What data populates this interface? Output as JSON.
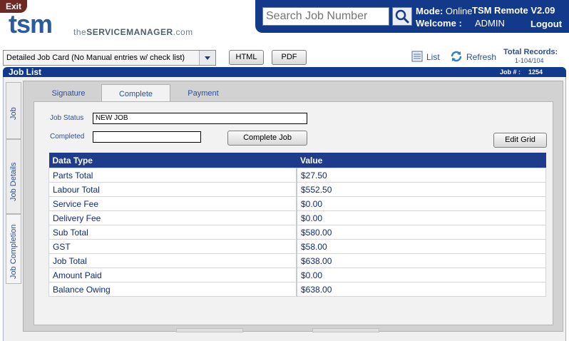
{
  "header": {
    "exit_label": "Exit",
    "logo_main": "tsm",
    "logo_sub_prefix": "the",
    "logo_sub_main": "SERVICEMANAGER",
    "logo_sub_suffix": ".com",
    "search_placeholder": "Search Job Number",
    "mode_label": "Mode:",
    "mode_value": "Online",
    "app_version": "TSM Remote V2.09",
    "welcome_label": "Welcome :",
    "welcome_user": "ADMIN",
    "logout_label": "Logout"
  },
  "toolbar": {
    "report_select": "Detailed Job Card (No Manual entries w/ check list)",
    "html_button": "HTML",
    "pdf_button": "PDF",
    "list_label": "List",
    "refresh_label": "Refresh",
    "total_records_label": "Total Records:",
    "total_records_value": "1-104/104"
  },
  "job_list": {
    "title": "Job List",
    "job_number_label": "Job # :",
    "job_number_value": "1254"
  },
  "side_tabs": [
    "Job",
    "Job Details",
    "Job Completion"
  ],
  "top_tabs": [
    "Signature",
    "Complete",
    "Payment"
  ],
  "form": {
    "job_status_label": "Job Status",
    "job_status_value": "NEW JOB",
    "completed_label": "Completed",
    "completed_value": "",
    "complete_job_button": "Complete Job",
    "edit_grid_button": "Edit Grid"
  },
  "grid": {
    "columns": [
      "Data Type",
      "Value"
    ],
    "rows": [
      [
        "Parts Total",
        "$27.50"
      ],
      [
        "Labour Total",
        "$552.50"
      ],
      [
        "Service Fee",
        "$0.00"
      ],
      [
        "Delivery Fee",
        "$0.00"
      ],
      [
        "Sub Total",
        "$580.00"
      ],
      [
        "GST",
        "$58.00"
      ],
      [
        "Job Total",
        "$638.00"
      ],
      [
        "Amount Paid",
        "$0.00"
      ],
      [
        "Balance Owing",
        "$638.00"
      ]
    ]
  },
  "colors": {
    "brand_navy": "#13398a",
    "header_blue": "#1f3c8c",
    "link_blue": "#2a4f96",
    "exit_red": "#6d2a24"
  }
}
